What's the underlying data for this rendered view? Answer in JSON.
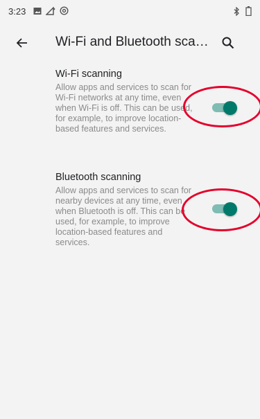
{
  "status": {
    "time": "3:23",
    "left_icons": [
      "image-icon",
      "signal-icon",
      "at-icon"
    ],
    "right_icons": [
      "bluetooth-icon",
      "battery-icon"
    ]
  },
  "appbar": {
    "title": "Wi-Fi and Bluetooth sca…",
    "back_icon": "arrow-back-icon",
    "search_icon": "search-icon"
  },
  "settings": [
    {
      "title": "Wi-Fi scanning",
      "summary": "Allow apps and services to scan for Wi-Fi networks at any time, even when Wi-Fi is off. This can be used, for example, to improve location-based features and services.",
      "enabled": true
    },
    {
      "title": "Bluetooth scanning",
      "summary": "Allow apps and services to scan for nearby devices at any time, even when Bluetooth is off. This can be used, for example, to improve location-based features and services.",
      "enabled": true
    }
  ],
  "colors": {
    "accent": "#00796b",
    "accent_track": "#7fbcb4",
    "annotation": "#e4002b",
    "background": "#f3f3f3"
  }
}
